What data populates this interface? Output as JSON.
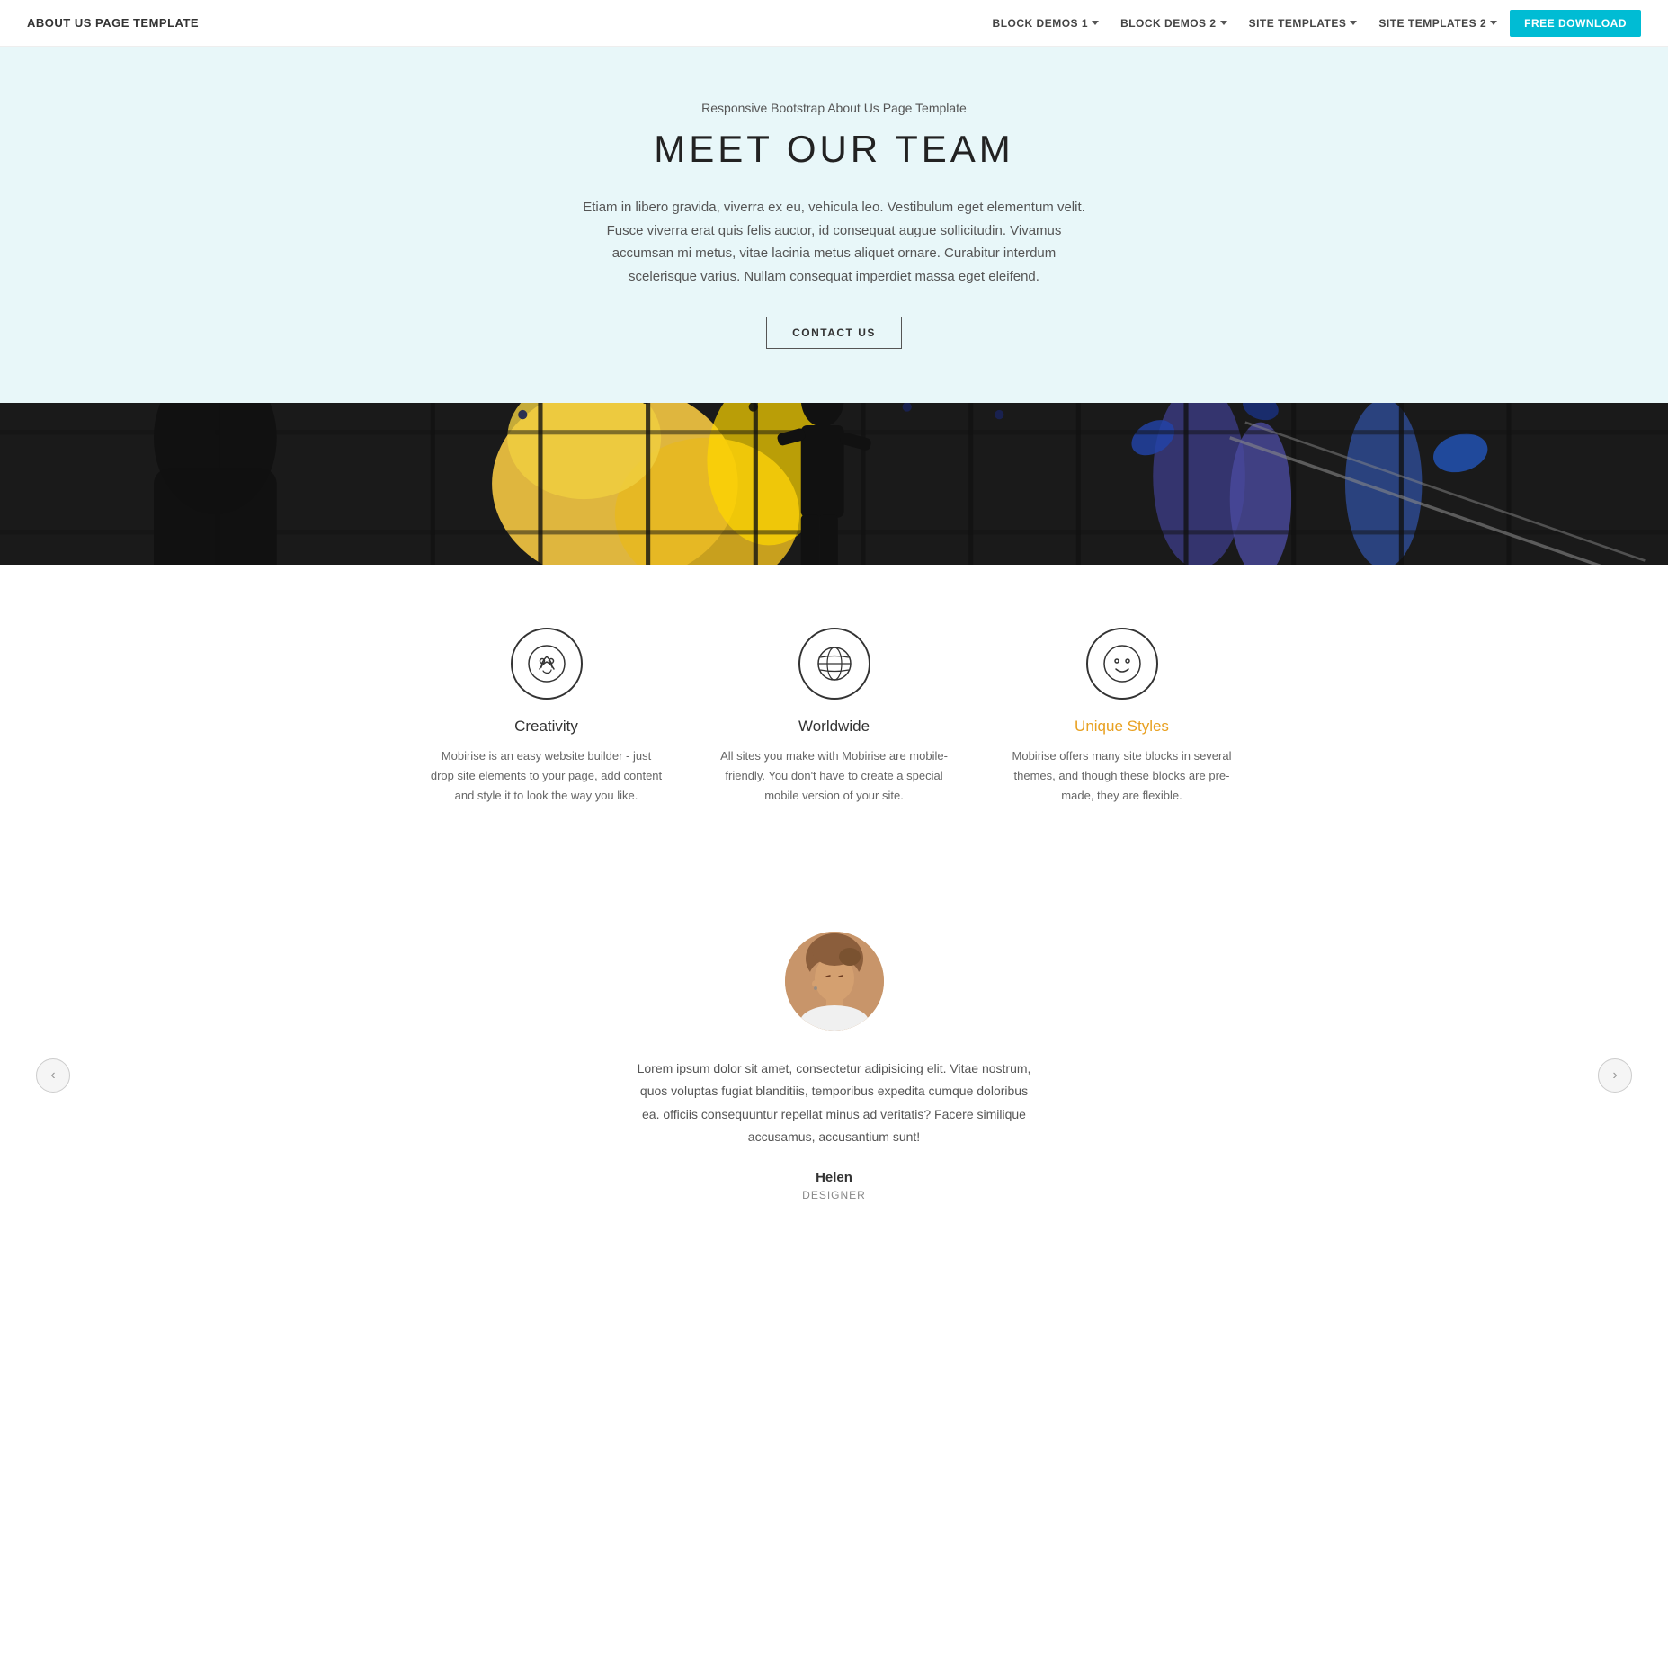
{
  "navbar": {
    "brand": "ABOUT US PAGE TEMPLATE",
    "nav_items": [
      {
        "label": "BLOCK DEMOS 1",
        "has_dropdown": true
      },
      {
        "label": "BLOCK DEMOS 2",
        "has_dropdown": true
      },
      {
        "label": "SITE TEMPLATES",
        "has_dropdown": true
      },
      {
        "label": "SITE TEMPLATES 2",
        "has_dropdown": true
      }
    ],
    "cta_button": "FREE DOWNLOAD"
  },
  "meet_section": {
    "subtitle": "Responsive Bootstrap About Us Page Template",
    "title": "MEET OUR TEAM",
    "description": "Etiam in libero gravida, viverra ex eu, vehicula leo. Vestibulum eget elementum velit. Fusce viverra erat quis felis auctor, id consequat augue sollicitudin. Vivamus accumsan mi metus, vitae lacinia metus aliquet ornare. Curabitur interdum scelerisque varius. Nullam consequat imperdiet massa eget eleifend.",
    "contact_button": "CONTACT US"
  },
  "features": {
    "items": [
      {
        "icon": "creativity-icon",
        "title": "Creativity",
        "description": "Mobirise is an easy website builder - just drop site elements to your page, add content and style it to look the way you like.",
        "accent": false
      },
      {
        "icon": "worldwide-icon",
        "title": "Worldwide",
        "description": "All sites you make with Mobirise are mobile-friendly. You don't have to create a special mobile version of your site.",
        "accent": false
      },
      {
        "icon": "unique-styles-icon",
        "title": "Unique Styles",
        "description": "Mobirise offers many site blocks in several themes, and though these blocks are pre-made, they are flexible.",
        "accent": true
      }
    ]
  },
  "testimonial": {
    "text": "Lorem ipsum dolor sit amet, consectetur adipisicing elit. Vitae nostrum, quos voluptas fugiat blanditiis, temporibus expedita cumque doloribus ea. officiis consequuntur repellat minus ad veritatis? Facere similique accusamus, accusantium sunt!",
    "name": "Helen",
    "role": "DESIGNER",
    "prev_label": "‹",
    "next_label": "›"
  },
  "colors": {
    "accent_cyan": "#00bcd4",
    "accent_gold": "#e8a020",
    "bg_light": "#e8f7f9"
  }
}
